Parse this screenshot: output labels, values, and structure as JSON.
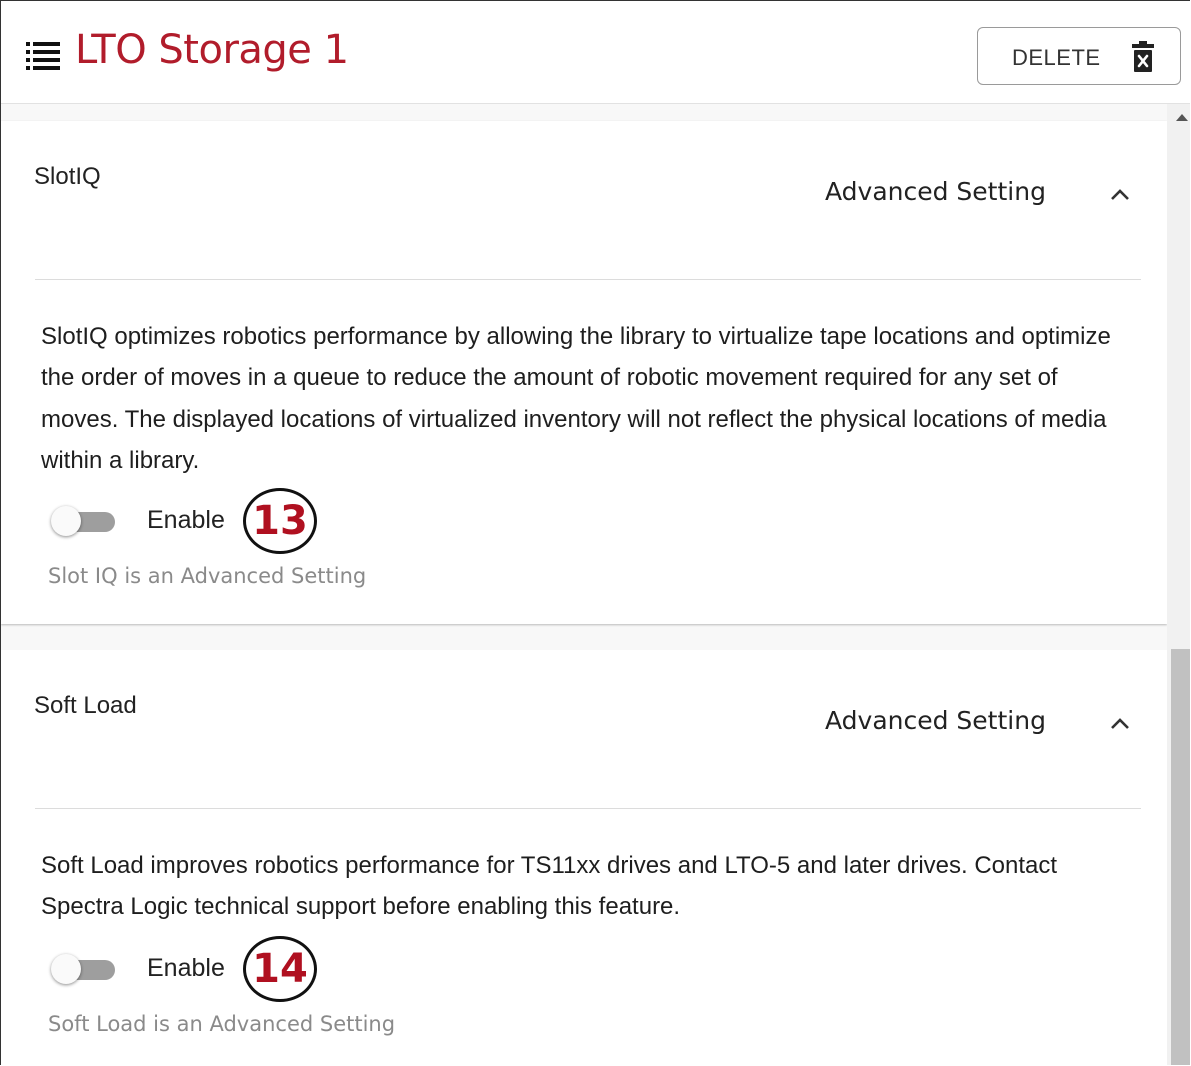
{
  "header": {
    "title": "LTO Storage 1",
    "delete_label": "DELETE",
    "accent_color": "#b11c2b"
  },
  "sections": [
    {
      "title": "SlotIQ",
      "advanced_label": "Advanced Setting",
      "description": "SlotIQ optimizes robotics performance by allowing the library to virtualize tape locations and optimize the order of moves in a queue to reduce the amount of robotic movement required for any set of moves. The displayed locations of virtualized inventory will not reflect the physical locations of media within a library.",
      "enable_label": "Enable",
      "enabled": false,
      "callout": "13",
      "hint": "Slot IQ is an Advanced Setting"
    },
    {
      "title": "Soft Load",
      "advanced_label": "Advanced Setting",
      "description": "Soft Load improves robotics performance for TS11xx drives and LTO-5 and later drives. Contact Spectra Logic technical support before enabling this feature.",
      "enable_label": "Enable",
      "enabled": false,
      "callout": "14",
      "hint": "Soft Load is an Advanced Setting"
    }
  ],
  "icons": {
    "menu": "menu-icon",
    "delete": "trash-icon",
    "collapse": "chevron-up-icon"
  }
}
